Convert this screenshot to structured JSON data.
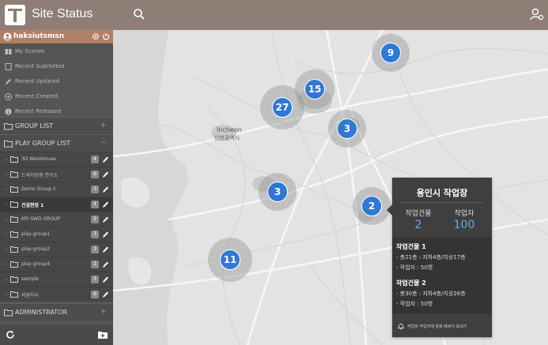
{
  "header": {
    "title": "Site Status"
  },
  "user": {
    "name": "haksiutsmsn"
  },
  "scenes": [
    {
      "label": "My Scenes",
      "icon": "book-icon"
    },
    {
      "label": "Recent Submitted",
      "icon": "document-icon"
    },
    {
      "label": "Recent Updated",
      "icon": "pencil-icon"
    },
    {
      "label": "Recent Created",
      "icon": "plus-circle-icon"
    },
    {
      "label": "Recent Released",
      "icon": "info-circle-icon"
    }
  ],
  "sections": {
    "group_list": {
      "label": "GROUP LIST",
      "toggle": "+"
    },
    "play_group_list": {
      "label": "PLAY GROUP LIST",
      "toggle": "−"
    },
    "administrator": {
      "label": "ADMINISTRATOR",
      "toggle": "+"
    }
  },
  "play_groups": [
    {
      "label": "3D Warehouse",
      "count": "4"
    },
    {
      "label": "드라이빙용 연구소",
      "count": "6"
    },
    {
      "label": "Demo Group 1",
      "count": "3"
    },
    {
      "label": "건설현장 1",
      "count": "4",
      "selected": true
    },
    {
      "label": "KPI SWD GROUP",
      "count": "2"
    },
    {
      "label": "play-group1",
      "count": "3"
    },
    {
      "label": "play-group2",
      "count": "3"
    },
    {
      "label": "play-group4",
      "count": "2"
    },
    {
      "label": "sample",
      "count": "5"
    },
    {
      "label": "지원하우",
      "count": "6"
    }
  ],
  "clusters": [
    {
      "count": "9"
    },
    {
      "count": "15"
    },
    {
      "count": "27"
    },
    {
      "count": "3"
    },
    {
      "count": "3"
    },
    {
      "count": "2"
    },
    {
      "count": "11"
    }
  ],
  "map_labels": {
    "incheon": "Incheon",
    "incheon_kr": "인천광역시"
  },
  "popup": {
    "title": "용인시 작업장",
    "buildings_label": "작업건물",
    "buildings_value": "2",
    "workers_label": "작업자",
    "workers_value": "100",
    "building1": {
      "title": "작업건물 1",
      "floors": "- 총21층 : 지하4층/지상17층",
      "workers": "- 작업자 : 50명"
    },
    "building2": {
      "title": "작업건물 2",
      "floors": "- 총30층 : 지하4층/지상26층",
      "workers": "- 작업자 : 50명"
    },
    "footer": "작업장 작업자에 알람 메세지 보내기"
  },
  "colors": {
    "topbar": "#8e7e76",
    "userbar": "#b08066",
    "sidebar": "#555555",
    "cluster": "#2f78d3",
    "popup": "#3f3f3f",
    "popup_value": "#6aa7ef"
  }
}
